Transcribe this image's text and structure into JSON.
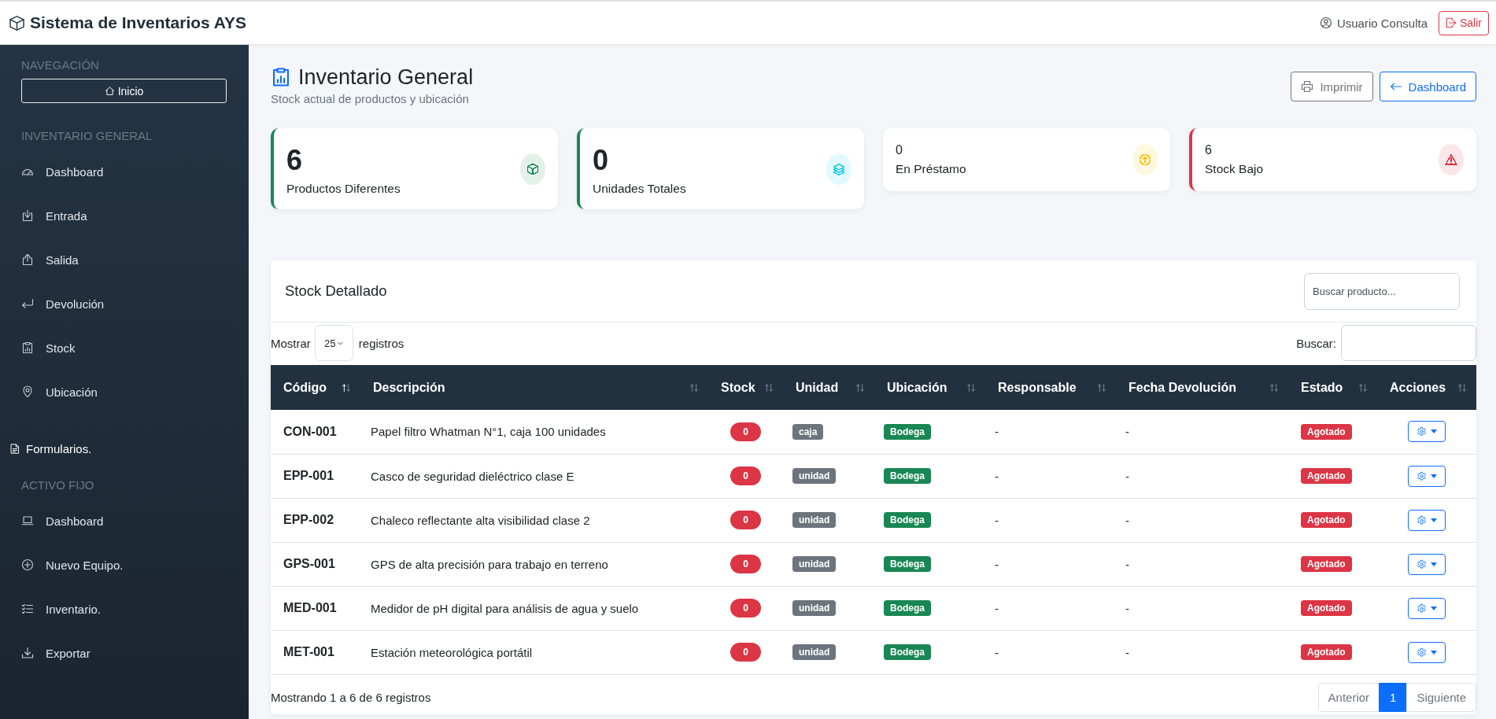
{
  "app": {
    "title": "Sistema de Inventarios AYS",
    "user": "Usuario Consulta",
    "logout": "Salir"
  },
  "sidebar": {
    "entries": [
      {
        "kind": "heading",
        "label": "NAVEGACIÓN"
      },
      {
        "kind": "button",
        "label": "Inicio"
      },
      {
        "kind": "heading",
        "label": "INVENTARIO GENERAL"
      },
      {
        "kind": "item",
        "label": "Dashboard"
      },
      {
        "kind": "item",
        "label": "Entrada"
      },
      {
        "kind": "item",
        "label": "Salida"
      },
      {
        "kind": "item",
        "label": "Devolución"
      },
      {
        "kind": "item",
        "label": "Stock"
      },
      {
        "kind": "item",
        "label": "Ubicación"
      },
      {
        "kind": "link",
        "label": "Formularios."
      },
      {
        "kind": "heading",
        "label": "ACTIVO FIJO"
      },
      {
        "kind": "item",
        "label": "Dashboard"
      },
      {
        "kind": "item",
        "label": "Nuevo Equipo."
      },
      {
        "kind": "item",
        "label": "Inventario."
      },
      {
        "kind": "item",
        "label": "Exportar"
      }
    ]
  },
  "page": {
    "title": "Inventario General",
    "subtitle": "Stock actual de productos y ubicación",
    "buttons": [
      {
        "kind": "secondary",
        "label": "Imprimir"
      },
      {
        "kind": "primary",
        "label": "Dashboard"
      }
    ]
  },
  "stats": [
    {
      "kind": "large",
      "value": "6",
      "label": "Productos Diferentes",
      "color": "#198754",
      "accent": {
        "color": "#198754"
      }
    },
    {
      "kind": "large",
      "value": "0",
      "label": "Unidades Totales",
      "color": "#0dcaf0",
      "accent": {
        "color": "#198754"
      }
    },
    {
      "kind": "compact",
      "value": "0",
      "label": "En Préstamo",
      "color": "#ffc107"
    },
    {
      "kind": "compact",
      "value": "6",
      "label": "Stock Bajo",
      "color": "#dc3545",
      "accent": {
        "color": "#dc3545"
      }
    }
  ],
  "stock_table": {
    "title": "Stock Detallado",
    "search": {
      "placeholder": "Buscar producto..."
    },
    "length": {
      "before": "Mostrar",
      "value": "25",
      "after": "registros"
    },
    "filter": {
      "label": "Buscar:"
    },
    "columns": [
      {
        "label": "Código",
        "sorted": true
      },
      {
        "label": "Descripción",
        "sorted": false
      },
      {
        "label": "Stock",
        "sorted": false
      },
      {
        "label": "Unidad",
        "sorted": false
      },
      {
        "label": "Ubicación",
        "sorted": false
      },
      {
        "label": "Responsable",
        "sorted": false
      },
      {
        "label": "Fecha Devolución",
        "sorted": false
      },
      {
        "label": "Estado",
        "sorted": false
      },
      {
        "label": "Acciones",
        "sorted": false
      }
    ],
    "rows": [
      {
        "code": "CON-001",
        "description": "Papel filtro Whatman N°1, caja 100 unidades",
        "stock": "0",
        "unit": "caja",
        "location": "Bodega",
        "responsible": "-",
        "return_date": "-",
        "status": "Agotado"
      },
      {
        "code": "EPP-001",
        "description": "Casco de seguridad dieléctrico clase E",
        "stock": "0",
        "unit": "unidad",
        "location": "Bodega",
        "responsible": "-",
        "return_date": "-",
        "status": "Agotado"
      },
      {
        "code": "EPP-002",
        "description": "Chaleco reflectante alta visibilidad clase 2",
        "stock": "0",
        "unit": "unidad",
        "location": "Bodega",
        "responsible": "-",
        "return_date": "-",
        "status": "Agotado"
      },
      {
        "code": "GPS-001",
        "description": "GPS de alta precisión para trabajo en terreno",
        "stock": "0",
        "unit": "unidad",
        "location": "Bodega",
        "responsible": "-",
        "return_date": "-",
        "status": "Agotado"
      },
      {
        "code": "MED-001",
        "description": "Medidor de pH digital para análisis de agua y suelo",
        "stock": "0",
        "unit": "unidad",
        "location": "Bodega",
        "responsible": "-",
        "return_date": "-",
        "status": "Agotado"
      },
      {
        "code": "MET-001",
        "description": "Estación meteorológica portátil",
        "stock": "0",
        "unit": "unidad",
        "location": "Bodega",
        "responsible": "-",
        "return_date": "-",
        "status": "Agotado"
      }
    ],
    "info": "Mostrando 1 a 6 de 6 registros",
    "pagination": [
      {
        "label": "Anterior",
        "selected": false
      },
      {
        "label": "1",
        "selected": true
      },
      {
        "label": "Siguiente",
        "selected": false
      }
    ]
  }
}
